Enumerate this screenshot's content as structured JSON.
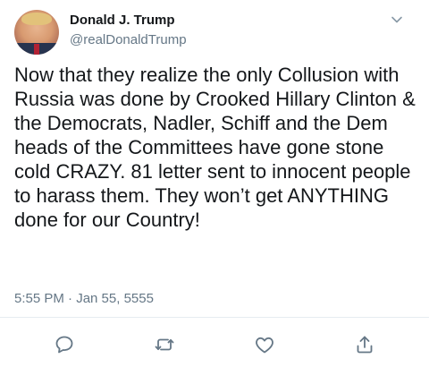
{
  "tweet": {
    "author": {
      "display_name": "Donald J. Trump",
      "handle": "@realDonaldTrump"
    },
    "text": "Now that they realize the only Collusion with Russia was done by Crooked Hillary Clinton & the Democrats, Nadler, Schiff and the Dem heads of the Committees have gone stone cold CRAZY. 81 letter sent to innocent people to harass them. They won’t get ANYTHING done for our Country!",
    "timestamp": "5:55 PM · Jan 55, 5555",
    "actions": {
      "reply_icon": "reply-icon",
      "retweet_icon": "retweet-icon",
      "like_icon": "heart-icon",
      "share_icon": "share-icon"
    },
    "menu_icon": "chevron-down-icon"
  },
  "colors": {
    "text_primary": "#14171a",
    "text_secondary": "#657786",
    "icon_gray": "#657786",
    "divider": "#e6ecf0",
    "background": "#ffffff"
  }
}
